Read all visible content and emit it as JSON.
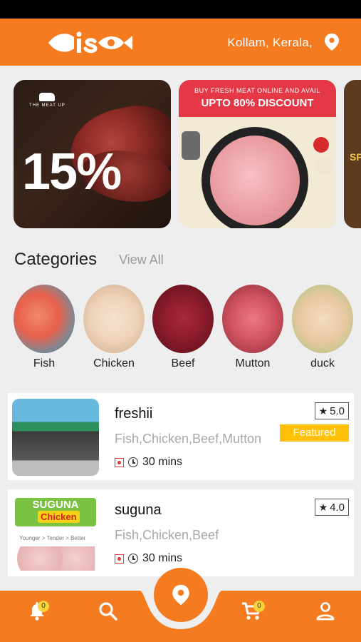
{
  "header": {
    "location": "Kollam, Kerala,",
    "logo_text": "fish"
  },
  "banners": [
    {
      "big_text": "15%",
      "brand": "THE MEAT UP"
    },
    {
      "line1": "BUY FRESH MEAT ONLINE AND AVAIL",
      "line2": "UPTO 80% DISCOUNT"
    },
    {
      "text": "SP"
    }
  ],
  "categories": {
    "title": "Categories",
    "view_all": "View All",
    "items": [
      {
        "label": "Fish",
        "icon": "fish-image"
      },
      {
        "label": "Chicken",
        "icon": "chicken-image"
      },
      {
        "label": "Beef",
        "icon": "beef-image"
      },
      {
        "label": "Mutton",
        "icon": "mutton-image"
      },
      {
        "label": "duck",
        "icon": "duck-image"
      }
    ]
  },
  "shops": [
    {
      "name": "freshii",
      "categories": "Fish,Chicken,Beef,Mutton",
      "time": "30 mins",
      "rating": "5.0",
      "badge": "Featured"
    },
    {
      "name": "suguna",
      "categories": "Fish,Chicken,Beef",
      "time": "30 mins",
      "rating": "4.0",
      "brand_logo": "SUGUNA",
      "brand_sub": "Chicken",
      "tagline": "Younger > Tender > Better"
    }
  ],
  "bottom_nav": {
    "notifications_badge": "0",
    "cart_badge": "0"
  },
  "colors": {
    "brand": "#f47b20",
    "featured": "#ffc107",
    "veg_mark": "#e53935"
  }
}
